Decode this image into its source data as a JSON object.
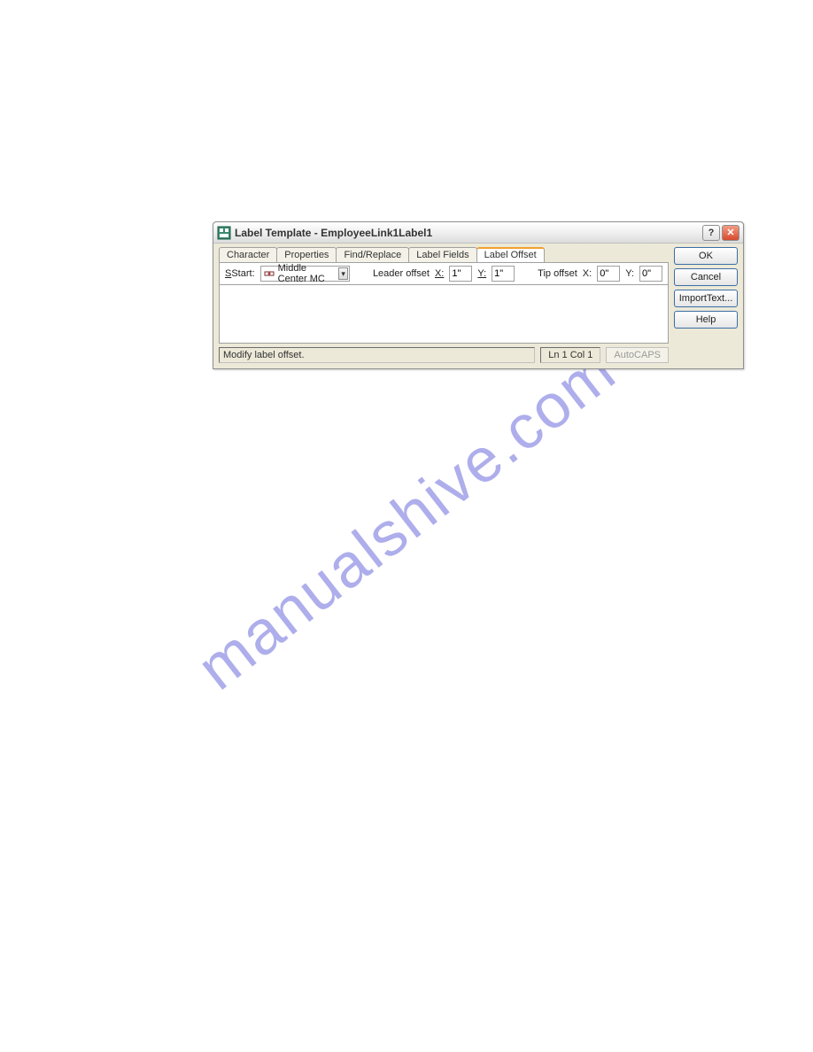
{
  "titlebar": {
    "title": "Label Template - EmployeeLink1Label1"
  },
  "tabs": [
    {
      "label": "Character"
    },
    {
      "label": "Properties"
    },
    {
      "label": "Find/Replace"
    },
    {
      "label": "Label Fields"
    },
    {
      "label": "Label Offset"
    }
  ],
  "offset_row": {
    "start_label": "Start:",
    "start_value": "Middle Center   MC",
    "leader_offset_label": "Leader offset",
    "x_label": "X:",
    "x_value": "1\"",
    "y_label": "Y:",
    "y_value": "1\"",
    "tip_offset_label": "Tip offset",
    "tip_x_label": "X:",
    "tip_x_value": "0\"",
    "tip_y_label": "Y:",
    "tip_y_value": "0\""
  },
  "status": {
    "text": "Modify label offset.",
    "position": "Ln 1 Col 1",
    "autocaps": "AutoCAPS"
  },
  "buttons": {
    "ok": "OK",
    "cancel": "Cancel",
    "import_text": "ImportText...",
    "help": "Help"
  },
  "watermark": "manualshive.com",
  "glyphs": {
    "close_x": "✕",
    "help_q": "?",
    "chevron_down": "▾"
  }
}
